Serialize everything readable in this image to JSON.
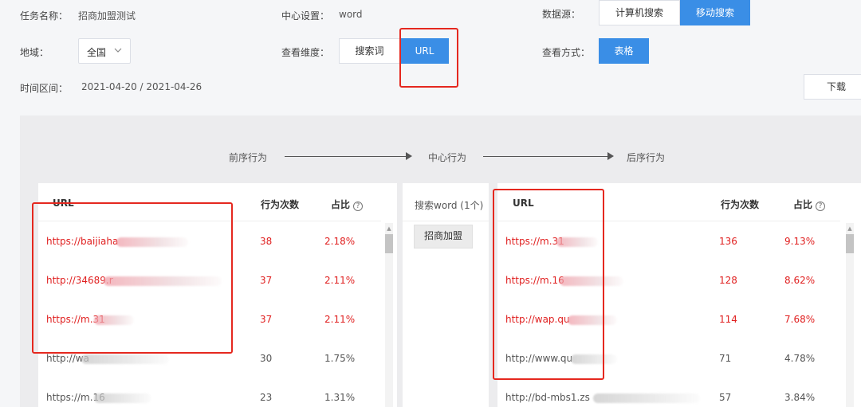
{
  "filters": {
    "task_label": "任务名称：",
    "task_value": "招商加盟测试",
    "center_label": "中心设置：",
    "center_value": "word",
    "source_label": "数据源：",
    "source_options": [
      "计算机搜索",
      "移动搜索"
    ],
    "source_selected": "移动搜索",
    "region_label": "地域：",
    "region_value": "全国",
    "dimension_label": "查看维度：",
    "dimension_options": [
      "搜索词",
      "URL"
    ],
    "dimension_selected": "URL",
    "view_label": "查看方式：",
    "view_value": "表格",
    "time_label": "时间区间：",
    "time_value": "2021-04-20 / 2021-04-26",
    "download_label": "下载"
  },
  "flow": {
    "pre": "前序行为",
    "center": "中心行为",
    "post": "后序行为"
  },
  "left_table": {
    "headers": [
      "URL",
      "行为次数",
      "占比"
    ],
    "rows": [
      {
        "url": "https://baijiaha",
        "count": "38",
        "pct": "2.18%",
        "color": "#e02020"
      },
      {
        "url": "http://34689.r",
        "count": "37",
        "pct": "2.11%",
        "color": "#e02020"
      },
      {
        "url": "https://m.31",
        "count": "37",
        "pct": "2.11%",
        "color": "#e02020"
      },
      {
        "url": "http://wa",
        "count": "30",
        "pct": "1.75%",
        "color": "#555555"
      },
      {
        "url": "https://m.16",
        "count": "23",
        "pct": "1.31%",
        "color": "#555555"
      }
    ]
  },
  "center_col": {
    "header": "搜索word (1个)",
    "tag": "招商加盟"
  },
  "right_table": {
    "headers": [
      "URL",
      "行为次数",
      "占比"
    ],
    "rows": [
      {
        "url": "https://m.31",
        "count": "136",
        "pct": "9.13%",
        "color": "#e02020"
      },
      {
        "url": "https://m.16",
        "count": "128",
        "pct": "8.62%",
        "color": "#e02020"
      },
      {
        "url": "http://wap.qu",
        "count": "114",
        "pct": "7.68%",
        "color": "#e02020"
      },
      {
        "url": "http://www.qu",
        "count": "71",
        "pct": "4.78%",
        "color": "#555555"
      },
      {
        "url": "http://bd-mbs1.zs",
        "count": "57",
        "pct": "3.84%",
        "color": "#555555"
      }
    ]
  },
  "icons": {
    "help": "question-circle-icon",
    "chevron": "chevron-down-icon",
    "arrow": "arrow-right-icon"
  },
  "colors": {
    "accent": "#3a8ee6",
    "highlight": "#e02020",
    "annotation": "#e5281f"
  }
}
